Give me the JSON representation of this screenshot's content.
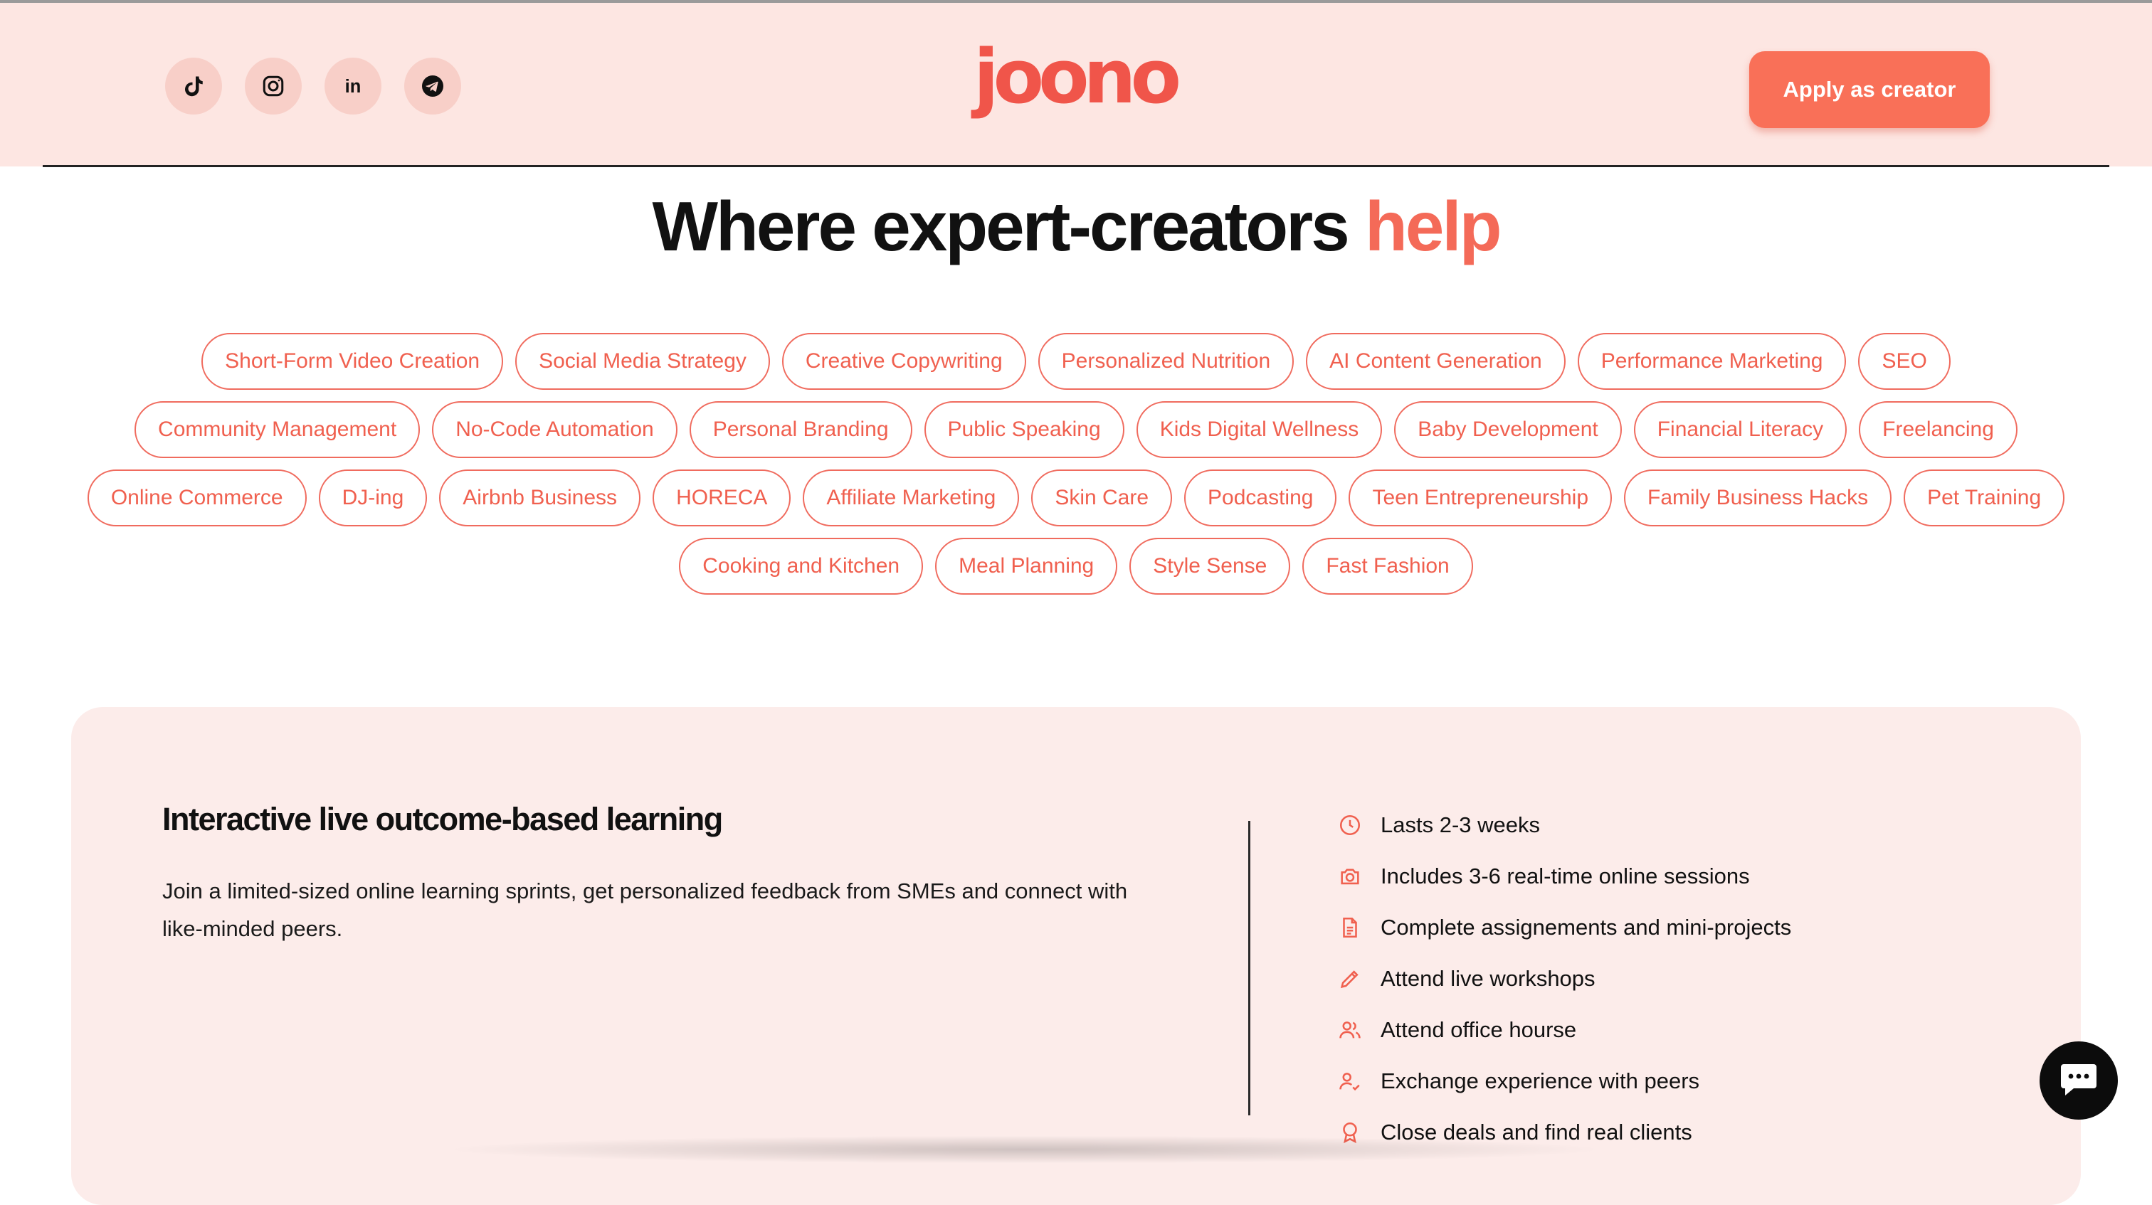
{
  "header": {
    "logo_text": "joono",
    "apply_label": "Apply as creator",
    "socials": [
      {
        "name": "tiktok-icon"
      },
      {
        "name": "instagram-icon"
      },
      {
        "name": "linkedin-icon",
        "text": "in"
      },
      {
        "name": "telegram-icon"
      }
    ]
  },
  "headline": {
    "main": "Where expert-creators",
    "accent": "help"
  },
  "tags": [
    "Short-Form Video Creation",
    "Social Media Strategy",
    "Creative Copywriting",
    "Personalized Nutrition",
    "AI Content Generation",
    "Performance Marketing",
    "SEO",
    "Community Management",
    "No-Code Automation",
    "Personal Branding",
    "Public Speaking",
    "Kids Digital Wellness",
    "Baby Development",
    "Financial Literacy",
    "Freelancing",
    "Online Commerce",
    "DJ-ing",
    "Airbnb Business",
    "HORECA",
    "Affiliate Marketing",
    "Skin Care",
    "Podcasting",
    "Teen Entrepreneurship",
    "Family Business Hacks",
    "Pet Training",
    "Cooking and Kitchen",
    "Meal Planning",
    "Style Sense",
    "Fast Fashion"
  ],
  "card": {
    "title": "Interactive live outcome-based learning",
    "description": "Join a limited-sized online learning sprints, get personalized feedback from SMEs and connect with like-minded peers.",
    "features": [
      {
        "icon": "clock-icon",
        "text": "Lasts 2-3 weeks"
      },
      {
        "icon": "camera-icon",
        "text": "Includes 3-6 real-time online sessions"
      },
      {
        "icon": "document-icon",
        "text": "Complete assignements and mini-projects"
      },
      {
        "icon": "pencil-icon",
        "text": "Attend live workshops"
      },
      {
        "icon": "users-icon",
        "text": "Attend office hourse"
      },
      {
        "icon": "user-check-icon",
        "text": "Exchange experience with peers"
      },
      {
        "icon": "award-icon",
        "text": "Close deals and find real clients"
      }
    ]
  },
  "colors": {
    "accent": "#f46a58",
    "header_bg": "#fde6e2",
    "card_bg": "#fcecea",
    "button_bg": "#f97058"
  }
}
